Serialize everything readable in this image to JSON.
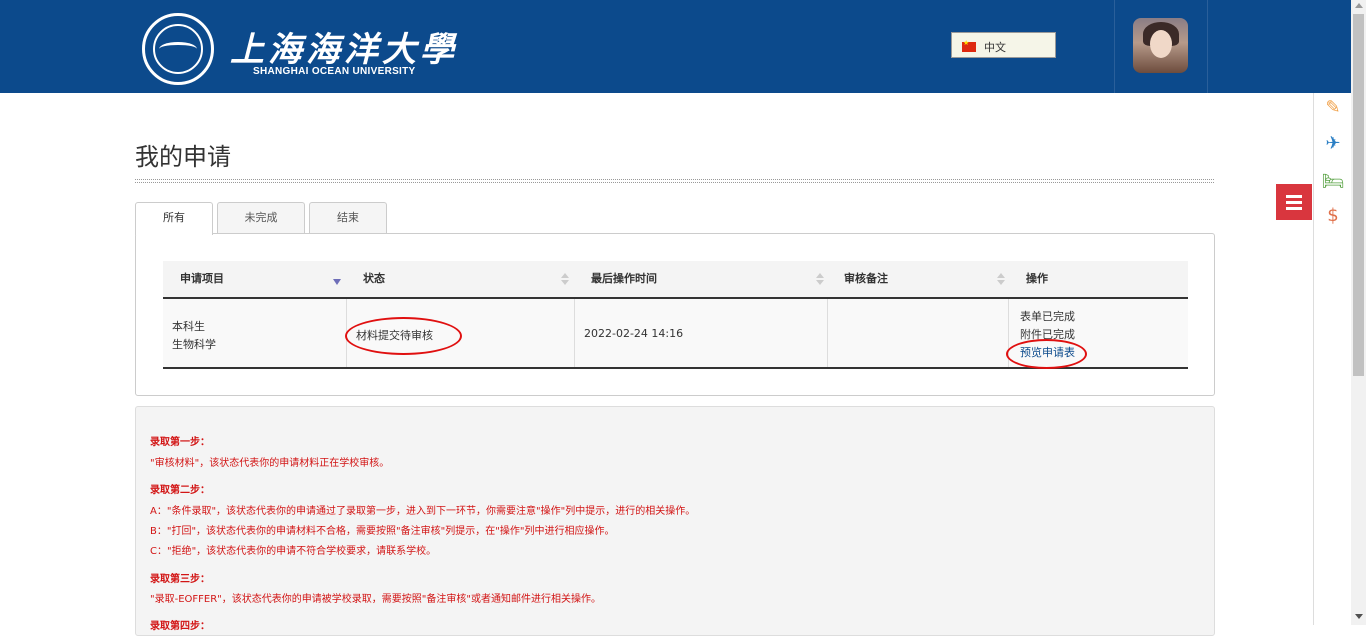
{
  "header": {
    "logo_cn": "上海海洋大學",
    "logo_en": "SHANGHAI OCEAN UNIVERSITY",
    "language": "中文",
    "colors": {
      "header_bg": "#0c4a8c",
      "accent_red": "#d9363e",
      "note_red": "#d21515"
    }
  },
  "side_tools": [
    {
      "icon": "edit-icon",
      "glyph": "✎",
      "color": "#f0a048"
    },
    {
      "icon": "plane-icon",
      "glyph": "✈",
      "color": "#2b7fc4"
    },
    {
      "icon": "bed-icon",
      "glyph": "🛏",
      "color": "#55a040"
    },
    {
      "icon": "dollar-icon",
      "glyph": "$",
      "color": "#e0704a"
    }
  ],
  "main": {
    "title": "我的申请",
    "tabs": [
      "所有",
      "未完成",
      "结束"
    ],
    "table": {
      "columns": [
        "申请项目",
        "状态",
        "最后操作时间",
        "审核备注",
        "操作"
      ],
      "rows": [
        {
          "program_line1": "本科生",
          "program_line2": "生物科学",
          "status": "材料提交待审核",
          "last_time": "2022-02-24 14:16",
          "remark": "",
          "action_line1": "表单已完成",
          "action_line2": "附件已完成",
          "action_link": "预览申请表"
        }
      ]
    }
  },
  "notes": {
    "step1_title": "录取第一步：",
    "step1_text": "\"审核材料\"，该状态代表你的申请材料正在学校审核。",
    "step2_title": "录取第二步：",
    "step2_a": "A：\"条件录取\"，该状态代表你的申请通过了录取第一步，进入到下一环节，你需要注意\"操作\"列中提示，进行的相关操作。",
    "step2_b": "B：\"打回\"，该状态代表你的申请材料不合格，需要按照\"备注审核\"列提示，在\"操作\"列中进行相应操作。",
    "step2_c": "C：\"拒绝\"，该状态代表你的申请不符合学校要求，请联系学校。",
    "step3_title": "录取第三步：",
    "step3_text": "\"录取-EOFFER\"，该状态代表你的申请被学校录取，需要按照\"备注审核\"或者通知邮件进行相关操作。",
    "step4_title": "录取第四步："
  }
}
